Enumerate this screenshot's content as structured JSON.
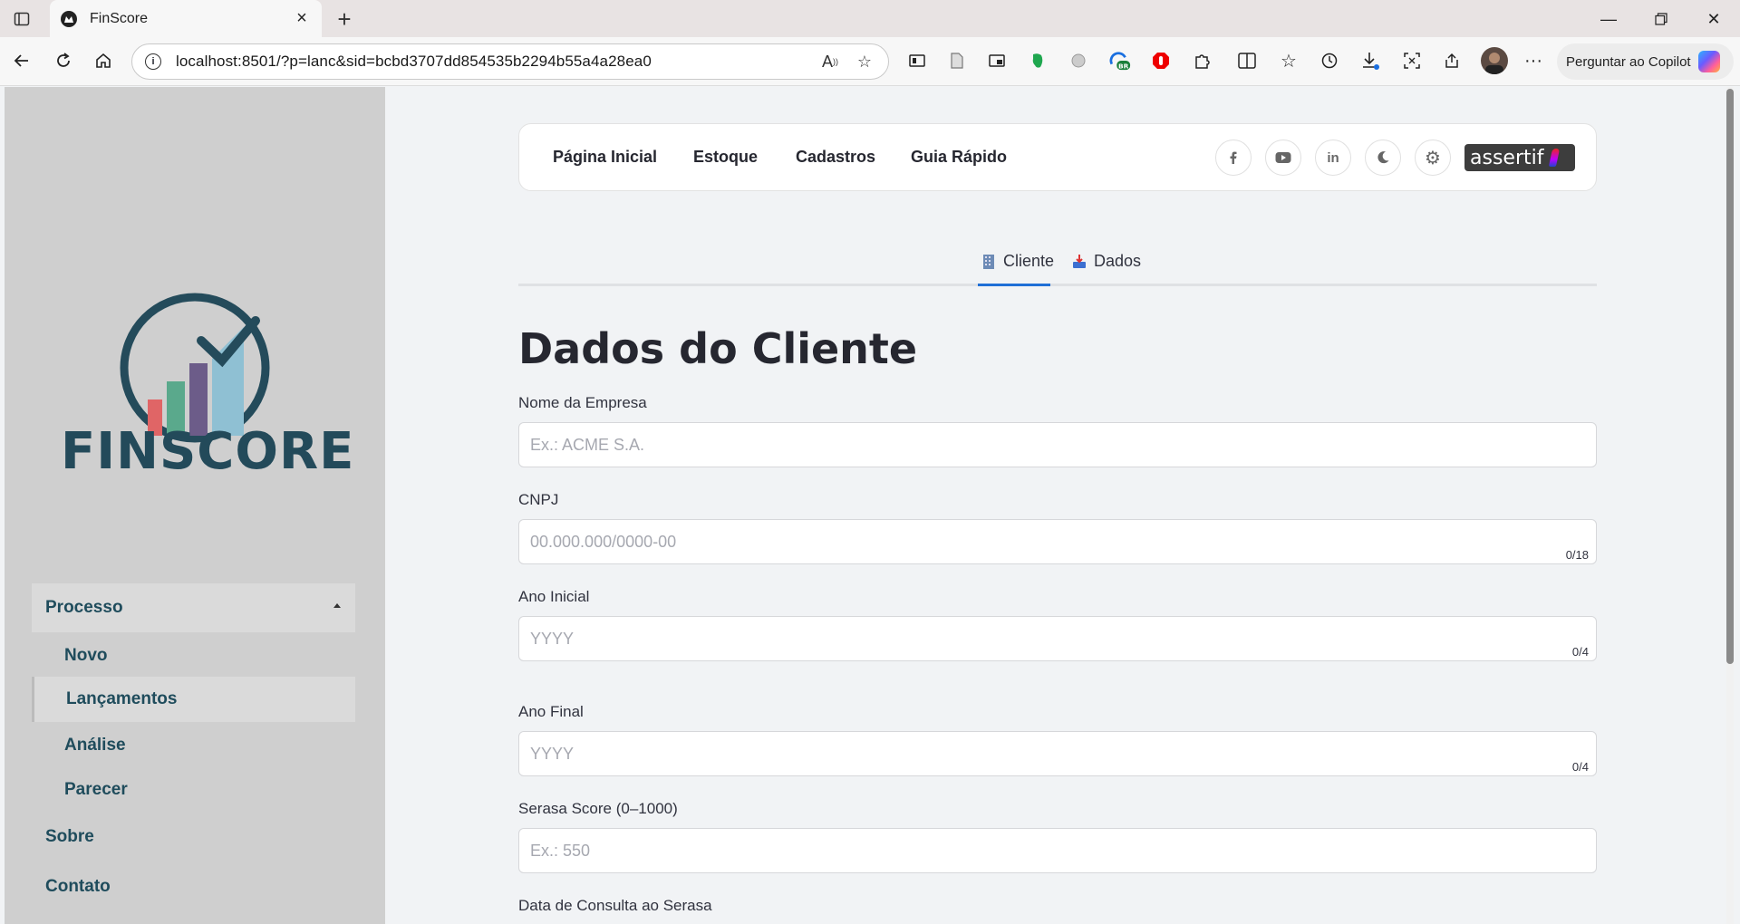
{
  "browser": {
    "tab_title": "FinScore",
    "url": "localhost:8501/?p=lanc&sid=bcbd3707dd854535b2294b55a4a28ea0",
    "copilot_label": "Perguntar ao Copilot"
  },
  "sidebar": {
    "logo_text": "FINSCORE",
    "section_label": "Processo",
    "items": [
      {
        "label": "Novo"
      },
      {
        "label": "Lançamentos"
      },
      {
        "label": "Análise"
      },
      {
        "label": "Parecer"
      }
    ],
    "about_label": "Sobre",
    "contact_label": "Contato"
  },
  "topnav": {
    "links": [
      "Página Inicial",
      "Estoque",
      "Cadastros",
      "Guia Rápido"
    ],
    "brand": "assertif"
  },
  "tabs": {
    "cliente": "Cliente",
    "dados": "Dados",
    "active": "Cliente"
  },
  "form": {
    "title": "Dados do Cliente",
    "fields": [
      {
        "label": "Nome da Empresa",
        "placeholder": "Ex.: ACME S.A.",
        "value": "",
        "counter": ""
      },
      {
        "label": "CNPJ",
        "placeholder": "00.000.000/0000-00",
        "value": "",
        "counter": "0/18"
      },
      {
        "label": "Ano Inicial",
        "placeholder": "YYYY",
        "value": "",
        "counter": "0/4"
      },
      {
        "label": "Ano Final",
        "placeholder": "YYYY",
        "value": "",
        "counter": "0/4"
      },
      {
        "label": "Serasa Score (0–1000)",
        "placeholder": "Ex.: 550",
        "value": "",
        "counter": ""
      },
      {
        "label": "Data de Consulta ao Serasa"
      }
    ]
  },
  "colors": {
    "sidebar_bg": "#cfcfcf",
    "brand_dark": "#234a5a",
    "tab_active": "#1f6fd6"
  }
}
